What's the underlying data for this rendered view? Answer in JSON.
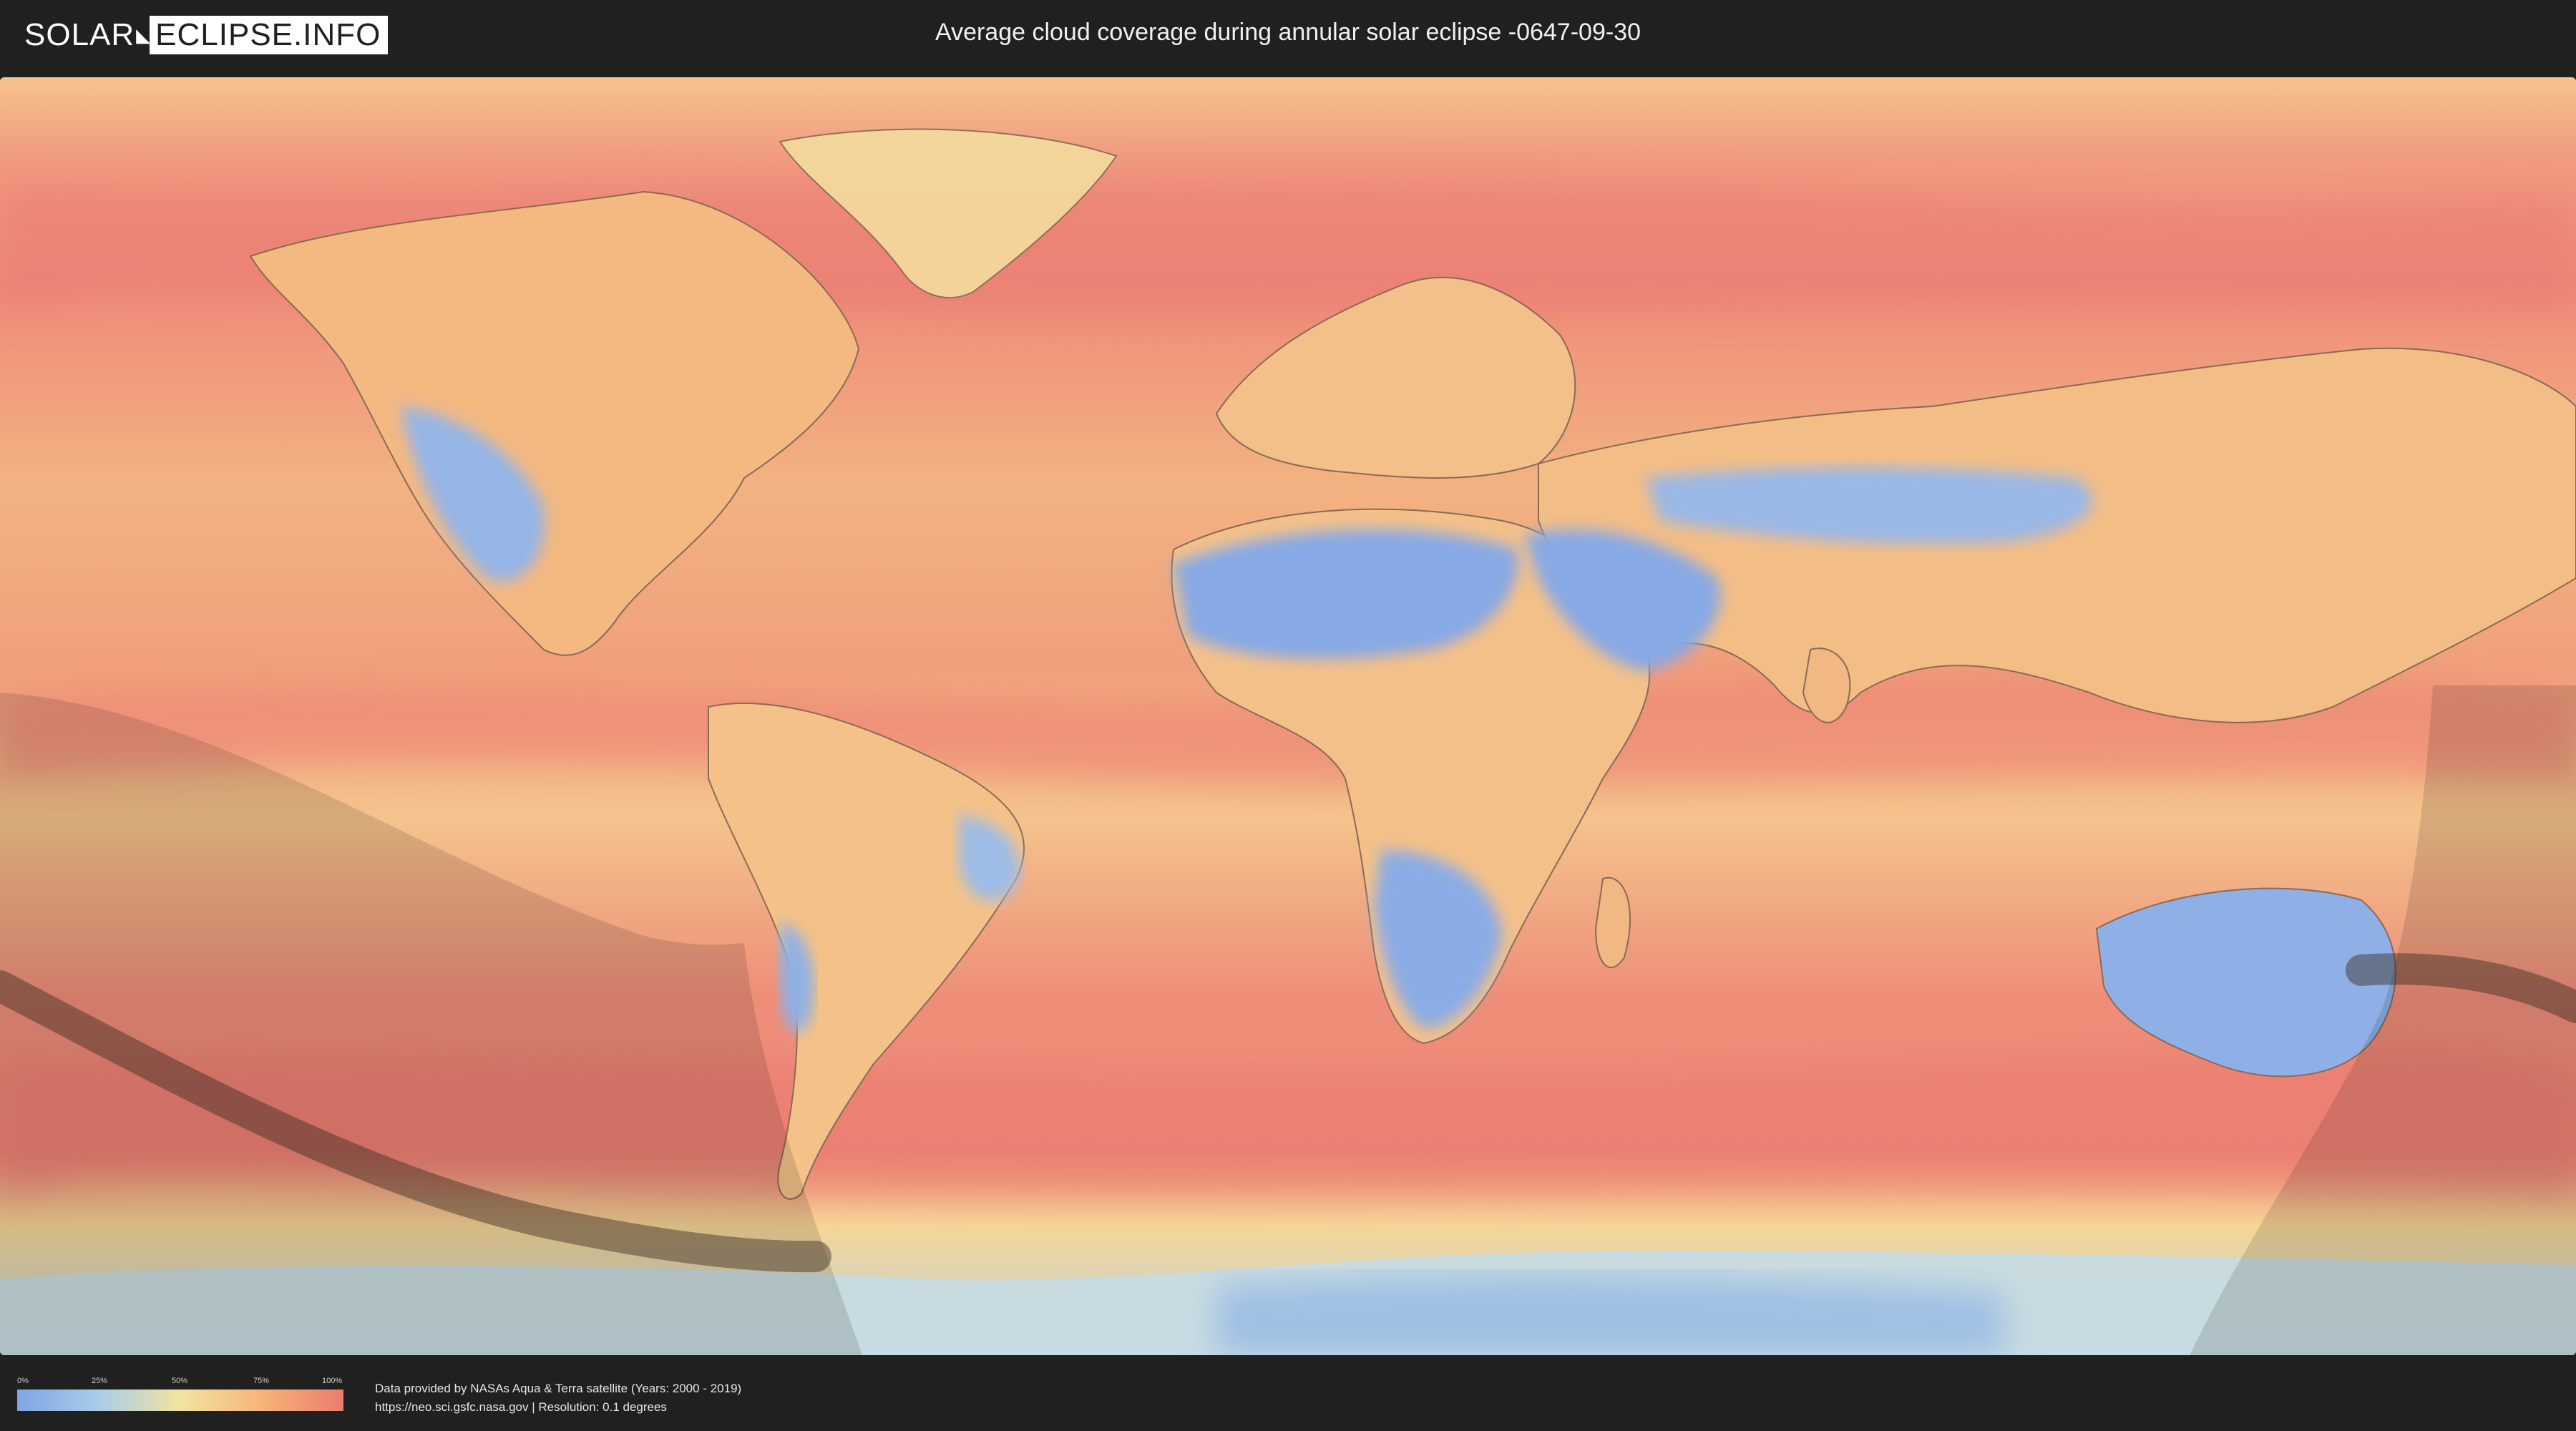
{
  "header": {
    "logo_left": "SOLAR",
    "logo_right": "ECLIPSE.INFO",
    "title": "Average cloud coverage during annular solar eclipse -0647-09-30"
  },
  "legend": {
    "ticks": [
      "0%",
      "25%",
      "50%",
      "75%",
      "100%"
    ],
    "colors": [
      "#7fa4e6",
      "#a9cde8",
      "#f2e3a0",
      "#f6b478",
      "#ec7b72"
    ]
  },
  "footer": {
    "line1": "Data provided by NASAs Aqua & Terra satellite (Years: 2000 - 2019)",
    "line2": "https://neo.sci.gsfc.nasa.gov | Resolution: 0.1 degrees"
  },
  "map": {
    "clear_color": "#86a9e6",
    "cloudy_color": "#ec7b72",
    "partial_color": "#f3cf8e"
  }
}
